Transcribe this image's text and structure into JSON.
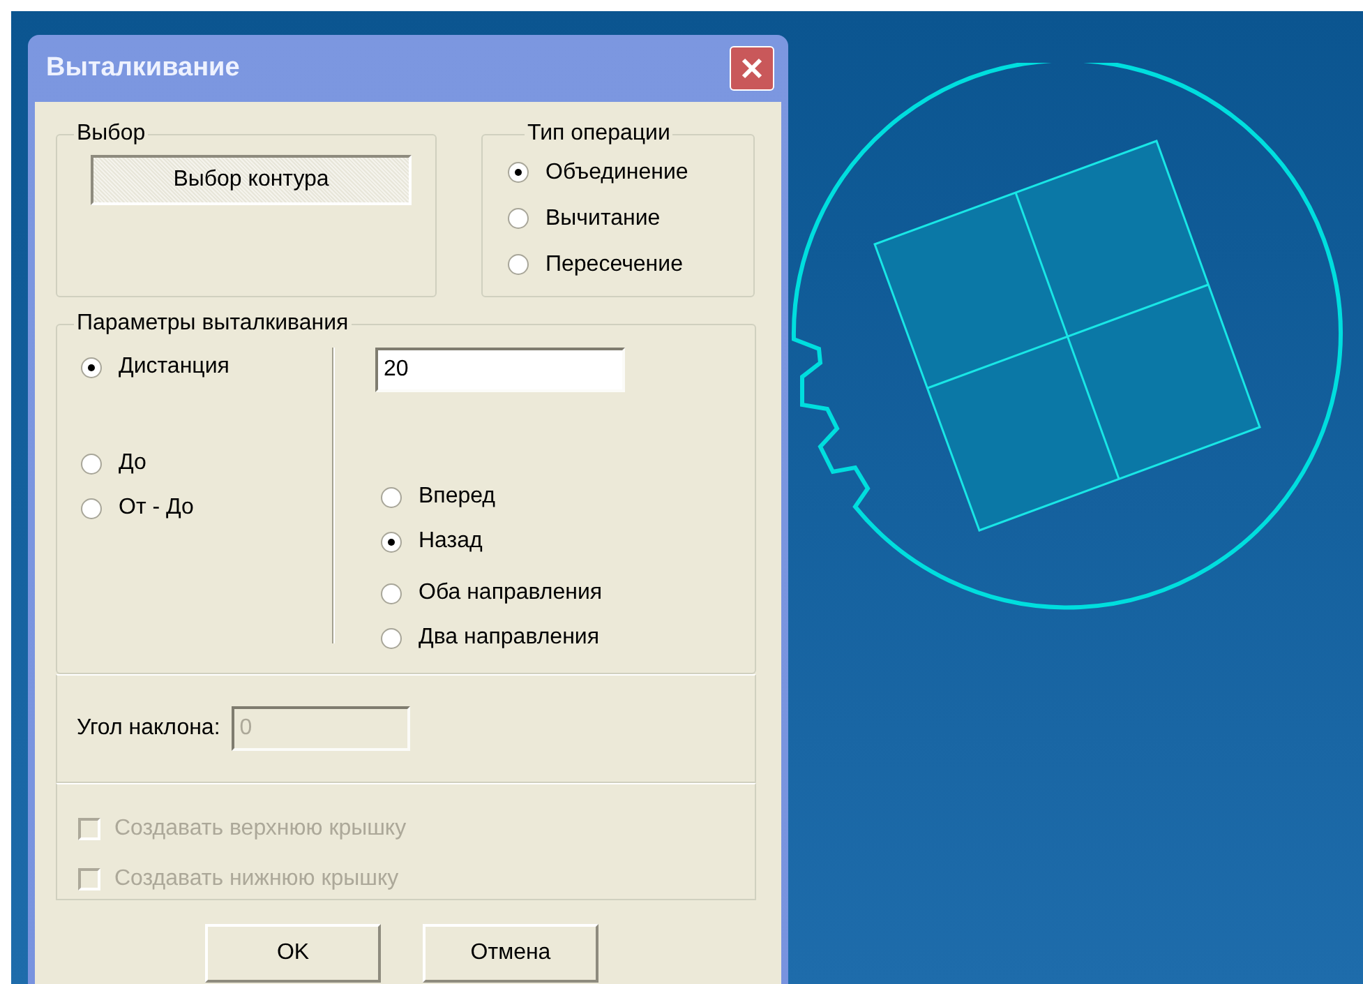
{
  "window": {
    "title": "Выталкивание"
  },
  "selection_group": {
    "legend": "Выбор",
    "button": "Выбор контура"
  },
  "operation_group": {
    "legend": "Тип операции",
    "options": [
      {
        "label": "Объединение",
        "selected": true
      },
      {
        "label": "Вычитание",
        "selected": false
      },
      {
        "label": "Пересечение",
        "selected": false
      }
    ]
  },
  "parameters_group": {
    "legend": "Параметры выталкивания",
    "modes": [
      {
        "label": "Дистанция",
        "selected": true
      },
      {
        "label": "До",
        "selected": false
      },
      {
        "label": "От - До",
        "selected": false
      }
    ],
    "distance": {
      "value": "20"
    },
    "directions": [
      {
        "label": "Вперед",
        "selected": false
      },
      {
        "label": "Назад",
        "selected": true
      },
      {
        "label": "Оба направления",
        "selected": false
      },
      {
        "label": "Два направления",
        "selected": false
      }
    ]
  },
  "draft_angle": {
    "label": "Угол наклона:",
    "value": "0",
    "disabled": true
  },
  "caps": [
    {
      "label": "Создавать верхнюю крышку",
      "checked": false,
      "disabled": true
    },
    {
      "label": "Создавать нижнюю крышку",
      "checked": false,
      "disabled": true
    }
  ],
  "buttons": [
    {
      "label": "OK"
    },
    {
      "label": "Отмена"
    }
  ]
}
